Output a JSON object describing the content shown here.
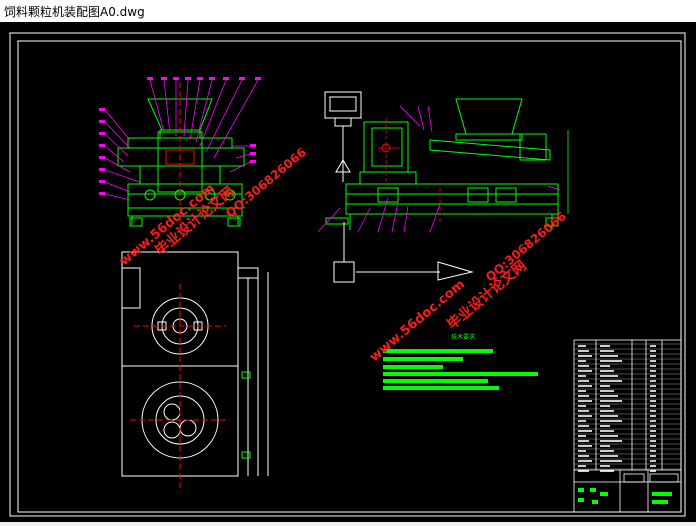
{
  "window": {
    "title": "饲料颗粒机装配图A0.dwg"
  },
  "colors": {
    "background": "#000000",
    "frame": "#ffffff",
    "geometry": "#00ff00",
    "centerline": "#ff0000",
    "leader": "#ff00ff",
    "watermark": "#ff1a1a",
    "annotation": "#00ff00",
    "table": "#ffffff"
  },
  "watermarks": {
    "site": "www.56doc.com",
    "brand": "毕业设计论文网",
    "qq": "QQ:306826066"
  },
  "tech_notes": {
    "heading": "技术要求"
  }
}
